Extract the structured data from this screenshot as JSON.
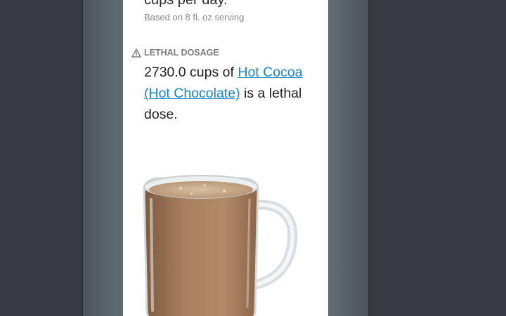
{
  "summary": {
    "cups_line": "cups per day.",
    "serving_note": "Based on 8 fl. oz serving"
  },
  "lethal": {
    "header_icon": "warning-triangle-icon",
    "header": "LETHAL DOSAGE",
    "amount_text": "2730.0 cups of ",
    "drink_link": "Hot Cocoa (Hot Chocolate)",
    "suffix_text": " is a lethal dose."
  },
  "image": {
    "subject": "hot-cocoa-mug"
  },
  "colors": {
    "background": "#373a41",
    "link": "#1a86c8",
    "header_gray": "#7c7c7c"
  }
}
